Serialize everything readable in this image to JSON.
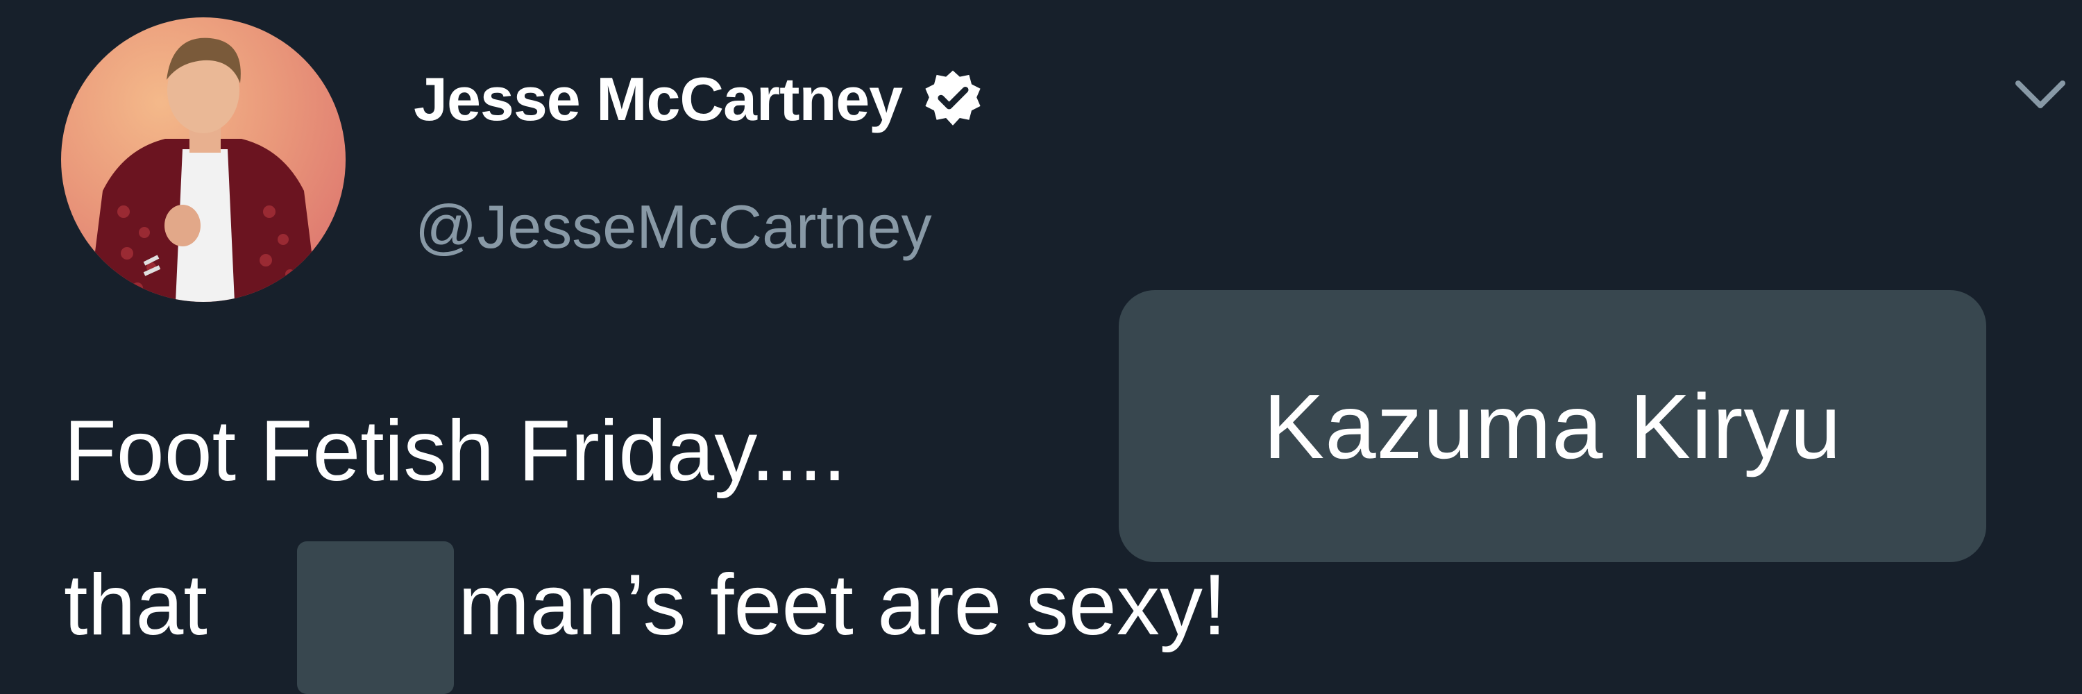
{
  "tweet": {
    "display_name": "Jesse McCartney",
    "handle": "@JesseMcCartney",
    "text_line1": "Foot Fetish Friday....",
    "text_line2_start": "that",
    "text_line2_end": "man’s feet are sexy!"
  },
  "overlay": {
    "label": "Kazuma Kiryu"
  },
  "icons": {
    "verified": "verified-badge-icon",
    "menu": "chevron-down-icon",
    "avatar": "profile-photo"
  },
  "colors": {
    "background": "#17202b",
    "name_text": "#ffffff",
    "handle_text": "#8899a6",
    "overlay_box": "#38474f"
  }
}
